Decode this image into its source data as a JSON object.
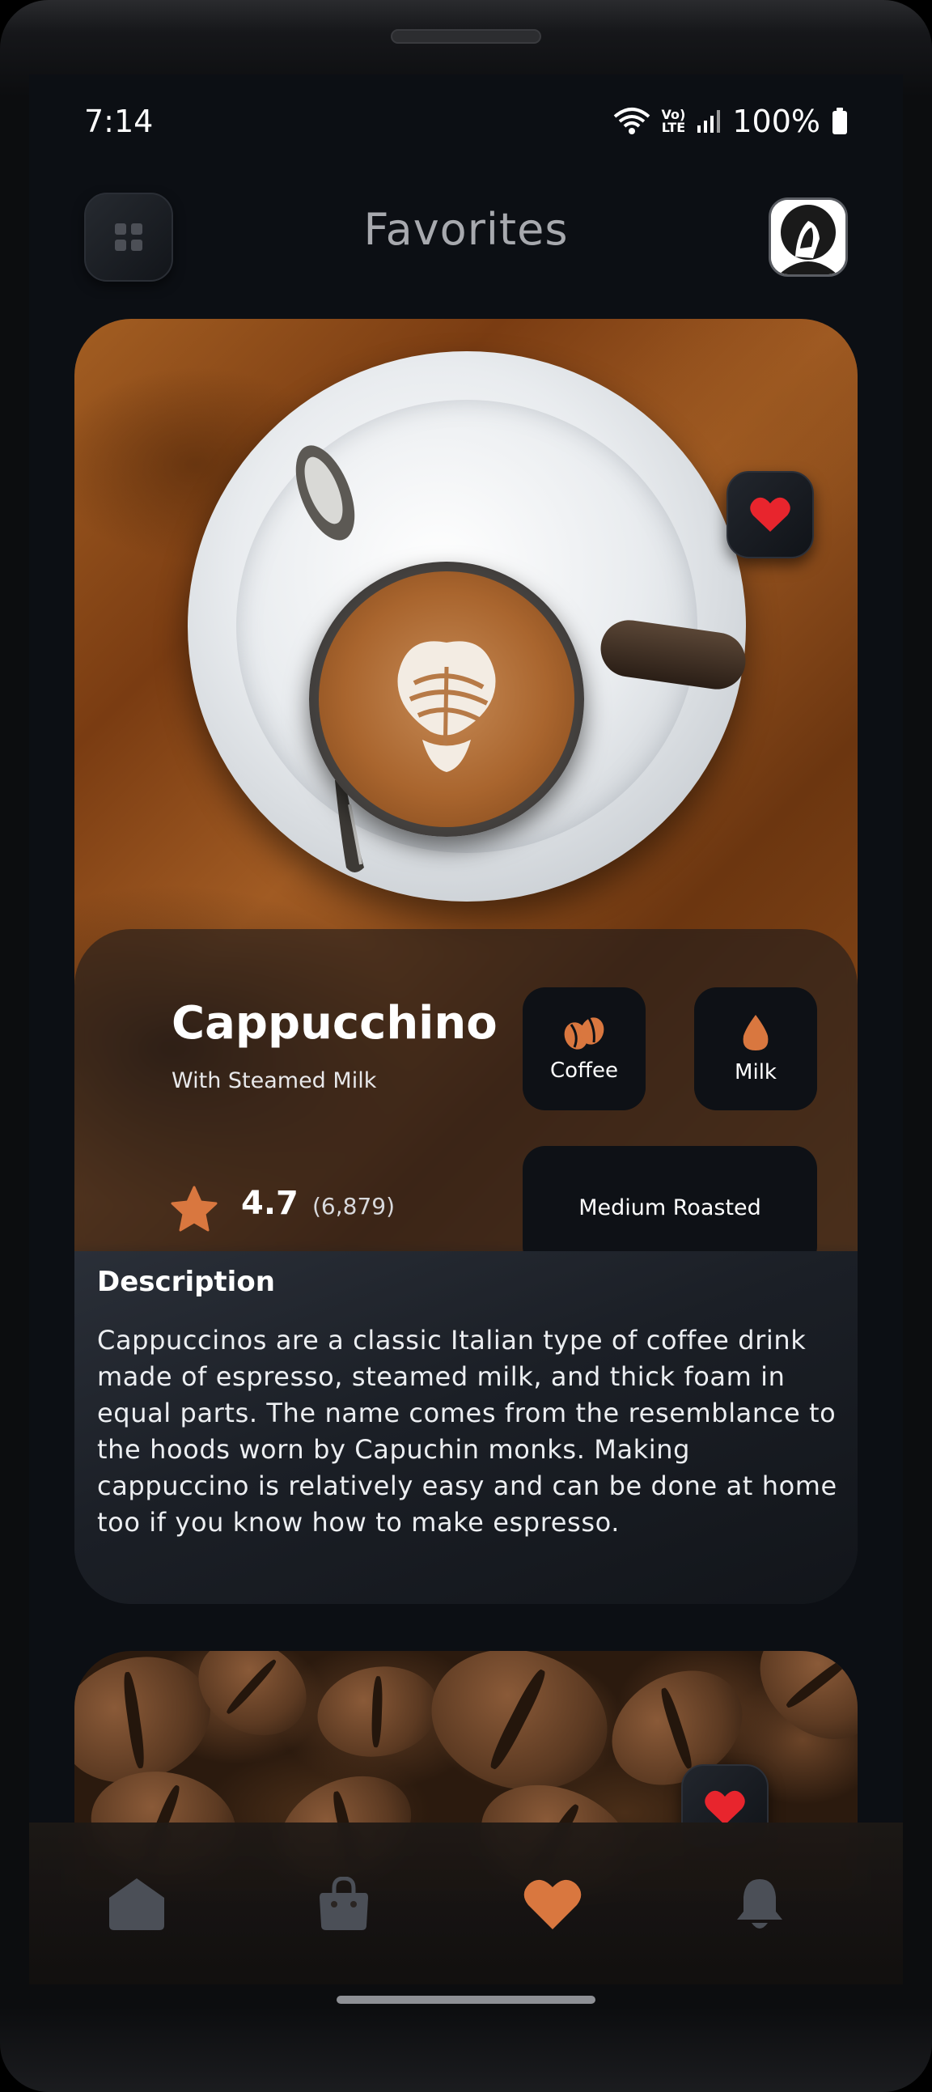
{
  "status_bar": {
    "time": "7:14",
    "volte": "Vo)\nLTE",
    "battery_percent": "100%"
  },
  "header": {
    "title": "Favorites",
    "menu_icon": "grid-icon",
    "avatar_icon": "avatar"
  },
  "item": {
    "name": "Cappucchino",
    "subtitle": "With Steamed Milk",
    "rating": "4.7",
    "rating_count": "(6,879)",
    "chips": {
      "coffee_label": "Coffee",
      "milk_label": "Milk",
      "roast_label": "Medium Roasted"
    },
    "favorite": true
  },
  "description": {
    "title": "Description",
    "text": "Cappuccinos are a classic Italian type of coffee drink made of espresso, steamed milk, and thick foam in equal parts. The name comes from the resemblance to the hoods worn by Capuchin monks. Making cappuccino is relatively easy and can be done at home too if you know how to make espresso."
  },
  "second_item": {
    "favorite": true
  },
  "bottom_nav": {
    "items": [
      {
        "icon": "home-icon",
        "active": false
      },
      {
        "icon": "bag-icon",
        "active": false
      },
      {
        "icon": "heart-icon",
        "active": true
      },
      {
        "icon": "bell-icon",
        "active": false
      }
    ]
  },
  "colors": {
    "accent": "#d9773f",
    "favorite_red": "#e8252d",
    "background": "#0c0f14",
    "inactive_icon": "#4b4f57"
  }
}
